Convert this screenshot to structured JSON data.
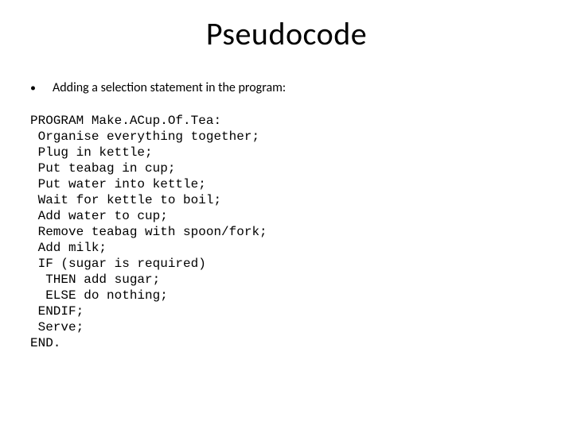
{
  "title": "Pseudocode",
  "bullet": {
    "marker": "•",
    "text": "Adding a selection statement in the program:"
  },
  "code": "PROGRAM Make.ACup.Of.Tea:\n Organise everything together;\n Plug in kettle;\n Put teabag in cup;\n Put water into kettle;\n Wait for kettle to boil;\n Add water to cup;\n Remove teabag with spoon/fork;\n Add milk;\n IF (sugar is required)\n  THEN add sugar;\n  ELSE do nothing;\n ENDIF;\n Serve;\nEND."
}
